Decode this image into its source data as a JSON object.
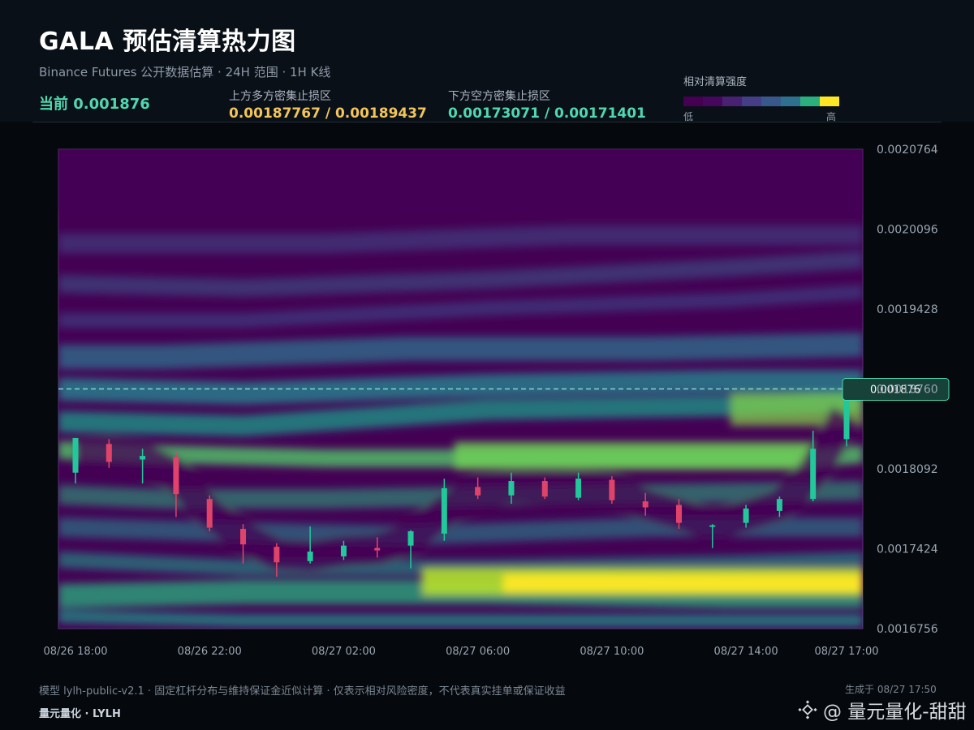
{
  "header": {
    "title": "GALA 预估清算热力图",
    "subtitle": "Binance Futures 公开数据估算 · 24H 范围 · 1H K线",
    "current_text": "当前 0.001876",
    "upper_label": "上方多方密集止损区",
    "upper_value": "0.00187767 / 0.00189437",
    "lower_label": "下方空方密集止损区",
    "lower_value": "0.00173071 / 0.00171401"
  },
  "legend": {
    "title": "相对清算强度",
    "low": "低",
    "high": "高",
    "colors": [
      "#440154",
      "#46085c",
      "#482173",
      "#433e85",
      "#38588c",
      "#2d718e",
      "#25858e",
      "#1e9b8a",
      "#2ab07f",
      "#52c569",
      "#86d549",
      "#fde725"
    ]
  },
  "chart_data": {
    "type": "heatmap",
    "overlay": "candlestick",
    "y_axis_ticks": [
      "0.0020764",
      "0.0020096",
      "0.0019428",
      "0.0018760",
      "0.0018092",
      "0.0017424",
      "0.0016756"
    ],
    "ylim": [
      0.0016756,
      0.0020764
    ],
    "x_axis_ticks": [
      "08/26 18:00",
      "08/26 22:00",
      "08/27 02:00",
      "08/27 06:00",
      "08/27 10:00",
      "08/27 14:00",
      "08/27 17:00"
    ],
    "current_price": 0.001876,
    "current_price_label": "0.001876",
    "colors": {
      "up": "#22c79a",
      "down": "#e0436a",
      "current_line": "#7fd8d0",
      "badge_bg": "#16423a",
      "badge_border": "#4fd8b0"
    },
    "candles": [
      {
        "t": "08/26 18:00",
        "o": 0.001806,
        "h": 0.001834,
        "l": 0.001797,
        "c": 0.001835
      },
      {
        "t": "08/26 19:00",
        "o": 0.00183,
        "h": 0.001834,
        "l": 0.00181,
        "c": 0.001815
      },
      {
        "t": "08/26 20:00",
        "o": 0.001817,
        "h": 0.001826,
        "l": 0.001797,
        "c": 0.00182
      },
      {
        "t": "08/26 21:00",
        "o": 0.001819,
        "h": 0.001823,
        "l": 0.001769,
        "c": 0.001788
      },
      {
        "t": "08/26 22:00",
        "o": 0.001784,
        "h": 0.001787,
        "l": 0.001757,
        "c": 0.00176
      },
      {
        "t": "08/26 23:00",
        "o": 0.001759,
        "h": 0.001763,
        "l": 0.00173,
        "c": 0.001746
      },
      {
        "t": "08/27 00:00",
        "o": 0.001744,
        "h": 0.001747,
        "l": 0.001719,
        "c": 0.001731
      },
      {
        "t": "08/27 01:00",
        "o": 0.001732,
        "h": 0.001761,
        "l": 0.00173,
        "c": 0.00174
      },
      {
        "t": "08/27 02:00",
        "o": 0.001736,
        "h": 0.001749,
        "l": 0.001733,
        "c": 0.001745
      },
      {
        "t": "08/27 03:00",
        "o": 0.001743,
        "h": 0.001752,
        "l": 0.001735,
        "c": 0.001741
      },
      {
        "t": "08/27 04:00",
        "o": 0.001745,
        "h": 0.001758,
        "l": 0.001726,
        "c": 0.001757
      },
      {
        "t": "08/27 05:00",
        "o": 0.001755,
        "h": 0.001801,
        "l": 0.001749,
        "c": 0.001793
      },
      {
        "t": "08/27 06:00",
        "o": 0.001794,
        "h": 0.001802,
        "l": 0.001784,
        "c": 0.001787
      },
      {
        "t": "08/27 07:00",
        "o": 0.001787,
        "h": 0.001806,
        "l": 0.00178,
        "c": 0.001799
      },
      {
        "t": "08/27 08:00",
        "o": 0.001799,
        "h": 0.001802,
        "l": 0.001784,
        "c": 0.001786
      },
      {
        "t": "08/27 09:00",
        "o": 0.001785,
        "h": 0.001806,
        "l": 0.001783,
        "c": 0.001801
      },
      {
        "t": "08/27 10:00",
        "o": 0.0018,
        "h": 0.001803,
        "l": 0.00178,
        "c": 0.001783
      },
      {
        "t": "08/27 11:00",
        "o": 0.001782,
        "h": 0.001789,
        "l": 0.00177,
        "c": 0.001777
      },
      {
        "t": "08/27 12:00",
        "o": 0.001779,
        "h": 0.001784,
        "l": 0.001759,
        "c": 0.001764
      },
      {
        "t": "08/27 13:00",
        "o": 0.001761,
        "h": 0.001763,
        "l": 0.001743,
        "c": 0.001762
      },
      {
        "t": "08/27 14:00",
        "o": 0.001764,
        "h": 0.001779,
        "l": 0.00176,
        "c": 0.001776
      },
      {
        "t": "08/27 15:00",
        "o": 0.001774,
        "h": 0.001786,
        "l": 0.001769,
        "c": 0.001784
      },
      {
        "t": "08/27 16:00",
        "o": 0.001784,
        "h": 0.001841,
        "l": 0.001782,
        "c": 0.001826
      },
      {
        "t": "08/27 17:00",
        "o": 0.001834,
        "h": 0.00188,
        "l": 0.001828,
        "c": 0.001875
      }
    ]
  },
  "footer": {
    "note": "模型 lylh-public-v2.1 · 固定杠杆分布与维持保证金近似计算 · 仅表示相对风险密度，不代表真实挂单或保证收益",
    "brand": "量元量化 · LYLH",
    "generated": "生成于 08/27 17:50",
    "watermark": "@ 量元量化-甜甜"
  }
}
